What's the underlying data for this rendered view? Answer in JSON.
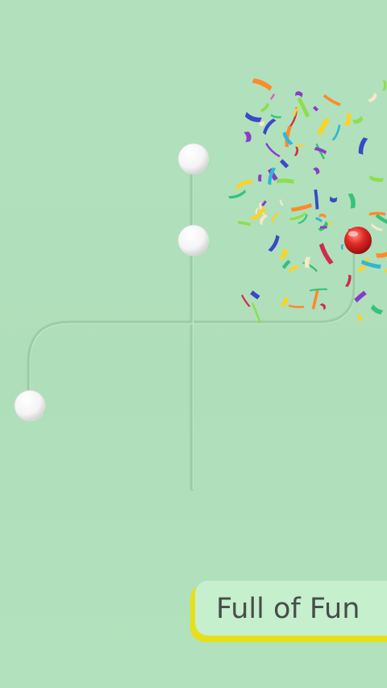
{
  "game": {
    "banner_text": "Full of Fun",
    "colors": {
      "background": "#b1e0bc",
      "track": "#96c8a2",
      "ball_white": "#ffffff",
      "ball_red": "#d42424",
      "banner_face": "#c6efcd",
      "banner_edge": "#e5e01b",
      "banner_text": "#474d4a"
    },
    "pieces": [
      {
        "name": "white-ball",
        "count": 3
      },
      {
        "name": "red-ball",
        "count": 1
      }
    ],
    "confetti_colors": [
      "#8a3cc9",
      "#d02a4f",
      "#3949c7",
      "#ffd21f",
      "#36c27a",
      "#2fb7d6",
      "#f5e8c8",
      "#ff8a2a",
      "#e84cc0",
      "#8be04a"
    ]
  }
}
